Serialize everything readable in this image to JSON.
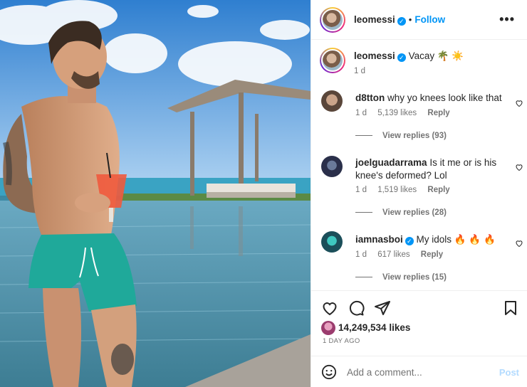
{
  "header": {
    "username": "leomessi",
    "verified": true,
    "separator": "•",
    "follow_label": "Follow",
    "more_icon": "more-horizontal-icon"
  },
  "caption": {
    "username": "leomessi",
    "text": "Vacay",
    "emojis": "🌴 ☀️",
    "time": "1 d"
  },
  "comments": [
    {
      "username": "d8tton",
      "verified": false,
      "text": "why yo knees look like that",
      "time": "1 d",
      "likes": "5,139 likes",
      "reply_label": "Reply",
      "view_replies": "View replies (93)"
    },
    {
      "username": "joelguadarrama",
      "verified": false,
      "text": "Is it me or is his knee's deformed? Lol",
      "time": "1 d",
      "likes": "1,519 likes",
      "reply_label": "Reply",
      "view_replies": "View replies (28)"
    },
    {
      "username": "iamnasboi",
      "verified": true,
      "text": "My idols",
      "emojis": "🔥 🔥 🔥",
      "time": "1 d",
      "likes": "617 likes",
      "reply_label": "Reply",
      "view_replies": "View replies (15)"
    }
  ],
  "actions": {
    "like_icon": "heart-icon",
    "comment_icon": "comment-icon",
    "share_icon": "send-icon",
    "save_icon": "bookmark-icon",
    "likes_count": "14,249,534 likes",
    "timestamp": "1 DAY AGO"
  },
  "add_comment": {
    "placeholder": "Add a comment...",
    "post_label": "Post",
    "emoji_icon": "smiley-icon"
  },
  "colors": {
    "accent": "#0095f6",
    "post_disabled": "#b3dbff",
    "text": "#262626",
    "secondary": "#737373",
    "swim_shorts": "#1fa99a"
  }
}
